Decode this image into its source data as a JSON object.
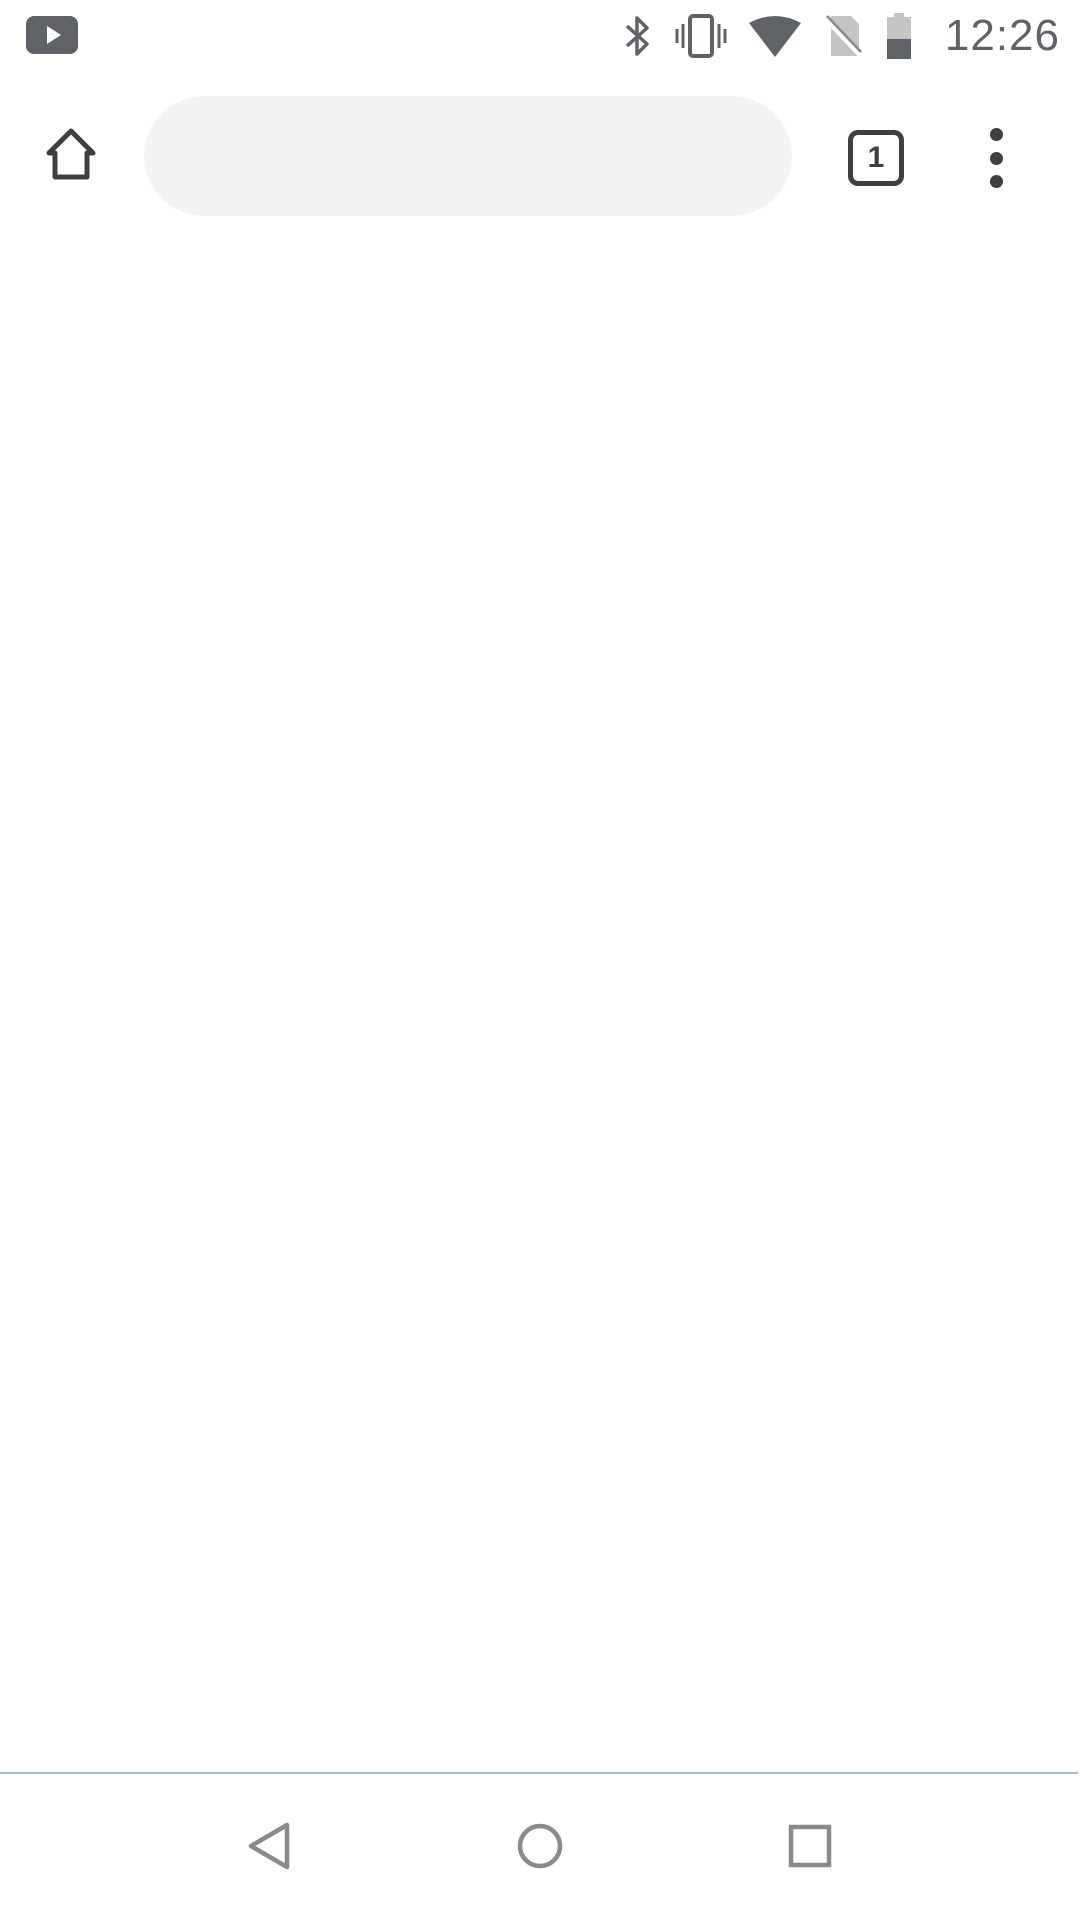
{
  "status_bar": {
    "time": "12:26",
    "icons": [
      "youtube-notification-icon",
      "bluetooth-icon",
      "vibrate-icon",
      "wifi-icon",
      "no-sim-icon",
      "battery-icon"
    ]
  },
  "toolbar": {
    "omnibox_value": "",
    "omnibox_placeholder": "",
    "tab_count": "1"
  },
  "navigation_bar": {
    "buttons": [
      "back",
      "home",
      "recents"
    ]
  },
  "colors": {
    "omnibox_background": "#f1f3f4",
    "icon_dark": "#3c4043",
    "status_icon": "#5f6368",
    "nav_icon": "#8a8a8a",
    "divider": "#9ec6d6"
  }
}
